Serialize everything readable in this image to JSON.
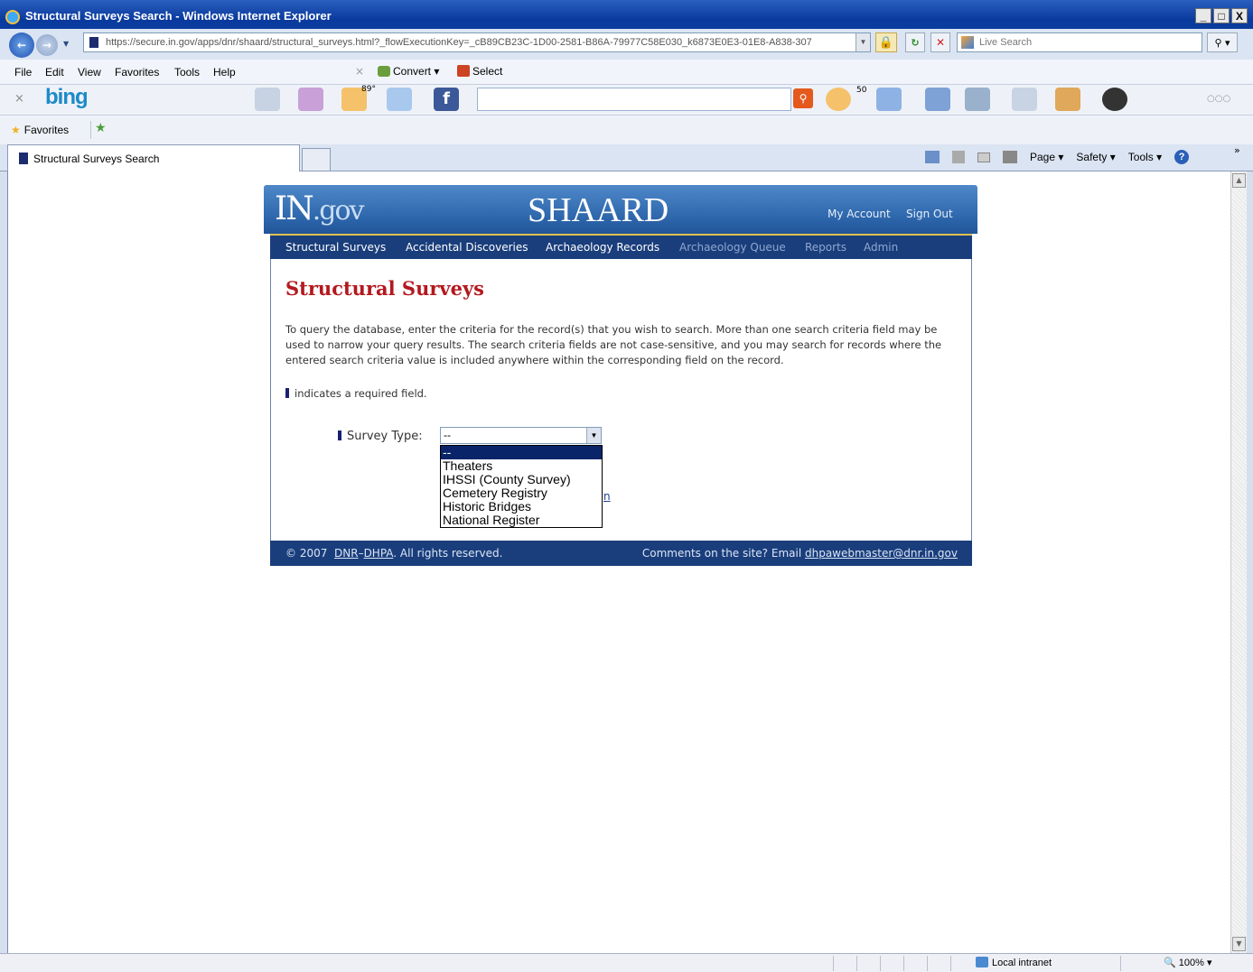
{
  "window": {
    "title": "Structural Surveys Search - Windows Internet Explorer",
    "controls": [
      "_",
      "□",
      "X"
    ]
  },
  "browser": {
    "url": "https://secure.in.gov/apps/dnr/shaard/structural_surveys.html?_flowExecutionKey=_cB89CB23C-1D00-2581-B86A-79977C58E030_k6873E0E3-01E8-A838-307",
    "search_placeholder": "Live Search",
    "menu": [
      "File",
      "Edit",
      "View",
      "Favorites",
      "Tools",
      "Help"
    ],
    "convert_label": "Convert",
    "select_label": "Select",
    "bing_logo": "bing",
    "weather_temp": "89°",
    "badge_count": "50",
    "favorites_label": "Favorites",
    "tab_title": "Structural Surveys Search",
    "command_bar": [
      "Page",
      "Safety",
      "Tools"
    ],
    "status_zone": "Local intranet",
    "zoom": "100%"
  },
  "site": {
    "logo_in": "IN",
    "logo_gov": ".gov",
    "title": "SHAARD",
    "account_links": [
      "My Account",
      "Sign Out"
    ],
    "nav": [
      "Structural Surveys",
      "Accidental Discoveries",
      "Archaeology Records",
      "Archaeology Queue",
      "Reports",
      "Admin"
    ],
    "page_heading": "Structural Surveys",
    "intro_text": "To query the database, enter the criteria for the record(s) that you wish to search. More than one search criteria field may be used to narrow your query results. The search criteria fields are not case-sensitive, and you may search for records where the entered search criteria value is included anywhere within the corresponding field on the record.",
    "required_note": "indicates a required field.",
    "survey_type_label": "Survey Type:",
    "survey_type_value": "--",
    "survey_type_options": [
      "--",
      "Theaters",
      "IHSSI (County Survey)",
      "Cemetery Registry",
      "Historic Bridges",
      "National Register"
    ],
    "hidden_link_fragment": "n",
    "footer": {
      "copyright_prefix": "© 2007",
      "org1": "DNR",
      "sep": "–",
      "org2": "DHPA",
      "rights": ". All rights reserved.",
      "contact_prefix": "Comments on the site? Email",
      "email": "dhpawebmaster@dnr.in.gov"
    }
  }
}
